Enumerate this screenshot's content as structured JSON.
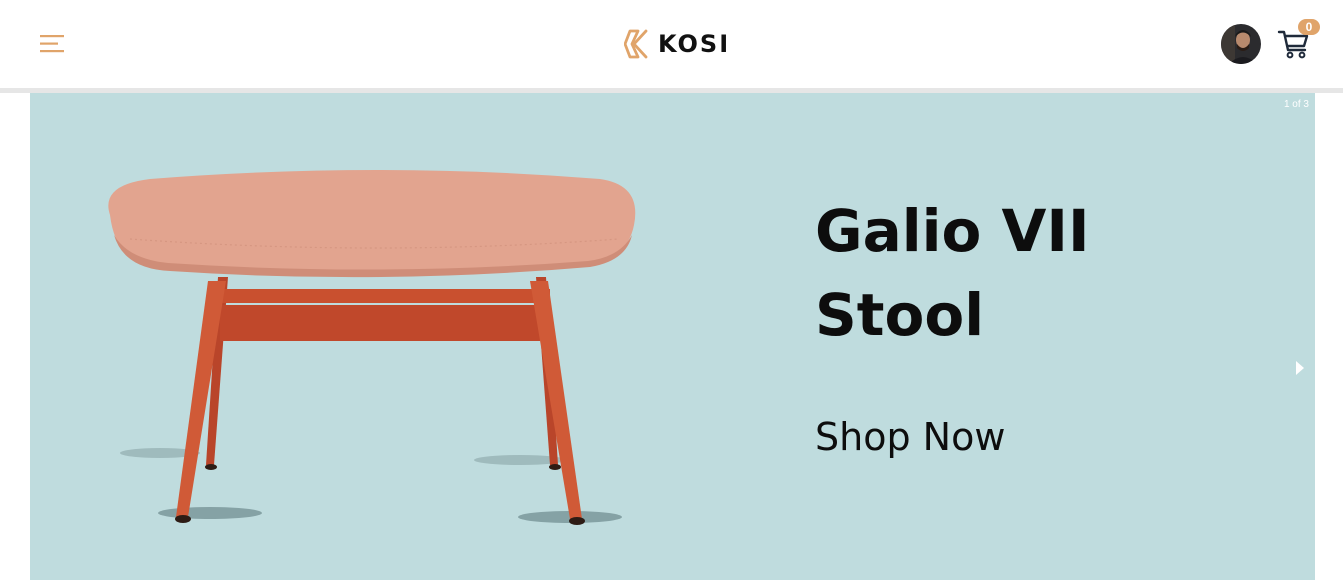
{
  "header": {
    "logo_text": "KOSI",
    "cart_count": "0"
  },
  "hero": {
    "slide_counter": "1 of 3",
    "title_line1": "Galio VII",
    "title_line2": "Stool",
    "cta_label": "Shop Now",
    "background_color": "#bfdcde"
  },
  "colors": {
    "accent": "#e0a46a",
    "stool_seat": "#e2a48f",
    "stool_legs": "#c9502f"
  },
  "icons": {
    "menu": "menu-icon",
    "logo_mark": "kosi-logo-mark-icon",
    "cart": "shopping-cart-icon",
    "next": "chevron-right-icon"
  }
}
